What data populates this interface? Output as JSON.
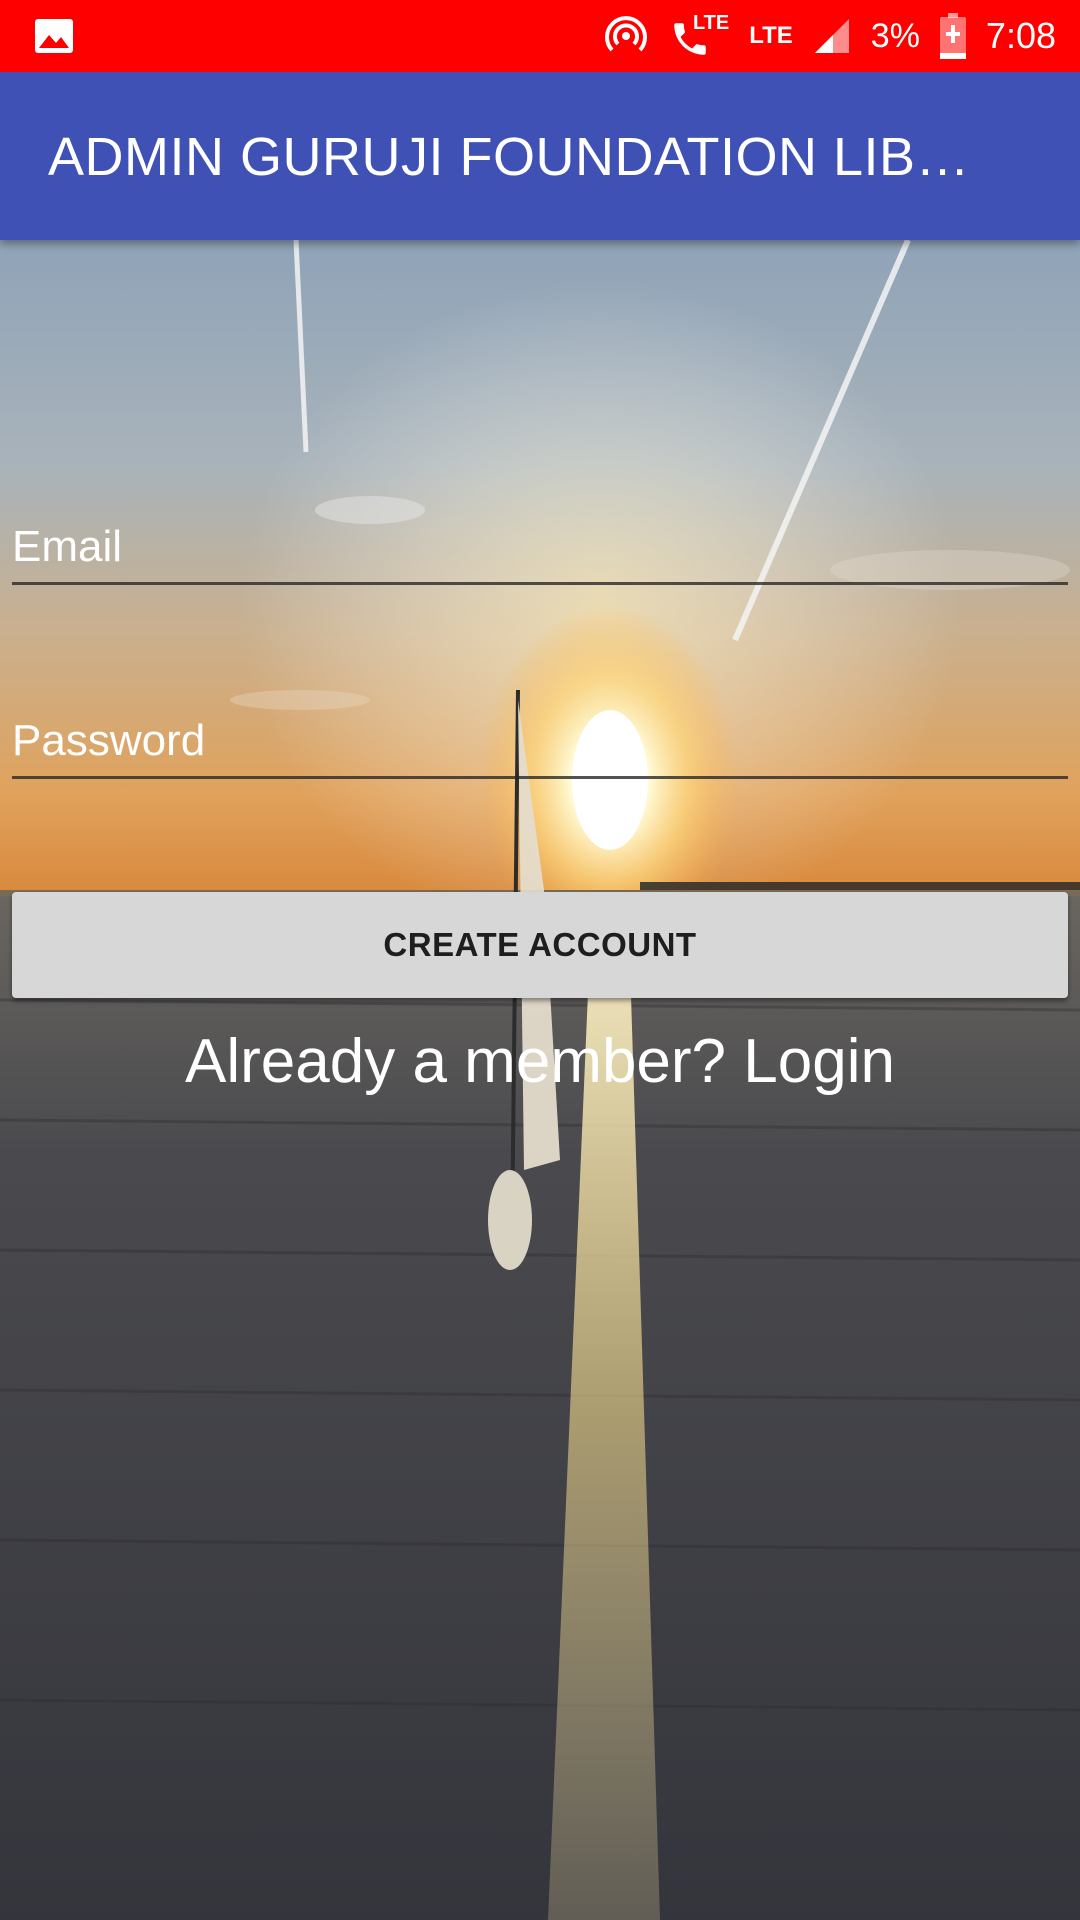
{
  "status_bar": {
    "icons": [
      "gallery-icon",
      "hotspot-icon",
      "volte-call-icon",
      "signal-icon",
      "battery-charging-icon"
    ],
    "call_lte": "LTE",
    "network": "LTE",
    "battery": "3%",
    "time": "7:08",
    "color": "#ff0000"
  },
  "app_bar": {
    "title": "ADMIN GURUJI FOUNDATION LIB…",
    "color": "#3f51b5"
  },
  "form": {
    "email": {
      "placeholder": "Email",
      "value": ""
    },
    "password": {
      "placeholder": "Password",
      "value": ""
    },
    "create_button": "CREATE ACCOUNT",
    "login_prompt": "Already a member? Login"
  },
  "colors": {
    "button": "#d7d7d7",
    "text_light": "#ffffff"
  }
}
